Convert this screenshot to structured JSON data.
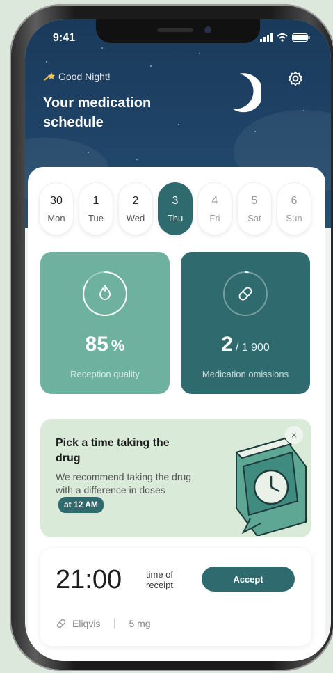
{
  "status_bar": {
    "time": "9:41"
  },
  "header": {
    "greeting": "Good Night!",
    "title": "Your medication schedule"
  },
  "days": [
    {
      "num": "30",
      "name": "Mon",
      "state": "past"
    },
    {
      "num": "1",
      "name": "Tue",
      "state": "past"
    },
    {
      "num": "2",
      "name": "Wed",
      "state": "past"
    },
    {
      "num": "3",
      "name": "Thu",
      "state": "active"
    },
    {
      "num": "4",
      "name": "Fri",
      "state": "future"
    },
    {
      "num": "5",
      "name": "Sat",
      "state": "future"
    },
    {
      "num": "6",
      "name": "Sun",
      "state": "future"
    }
  ],
  "stats": {
    "quality": {
      "value": "85",
      "suffix": "%",
      "label": "Reception quality",
      "progress": 0.85
    },
    "omissions": {
      "value": "2",
      "of": "/ 1 900",
      "label": "Medication omissions",
      "progress": 0.02
    }
  },
  "tip": {
    "title": "Pick a time taking the drug",
    "body": "We recommend taking the drug with a difference in doses",
    "badge": "at 12 AM",
    "close": "×"
  },
  "receipt": {
    "time": "21:00",
    "label": "time of receipt",
    "accept": "Accept",
    "drug": "Eliqvis",
    "dose": "5 mg"
  },
  "colors": {
    "sky": "#1f4468",
    "accent_dark": "#2f6b6e",
    "accent_light": "#6db19e",
    "tip_bg": "#d9ead9"
  }
}
